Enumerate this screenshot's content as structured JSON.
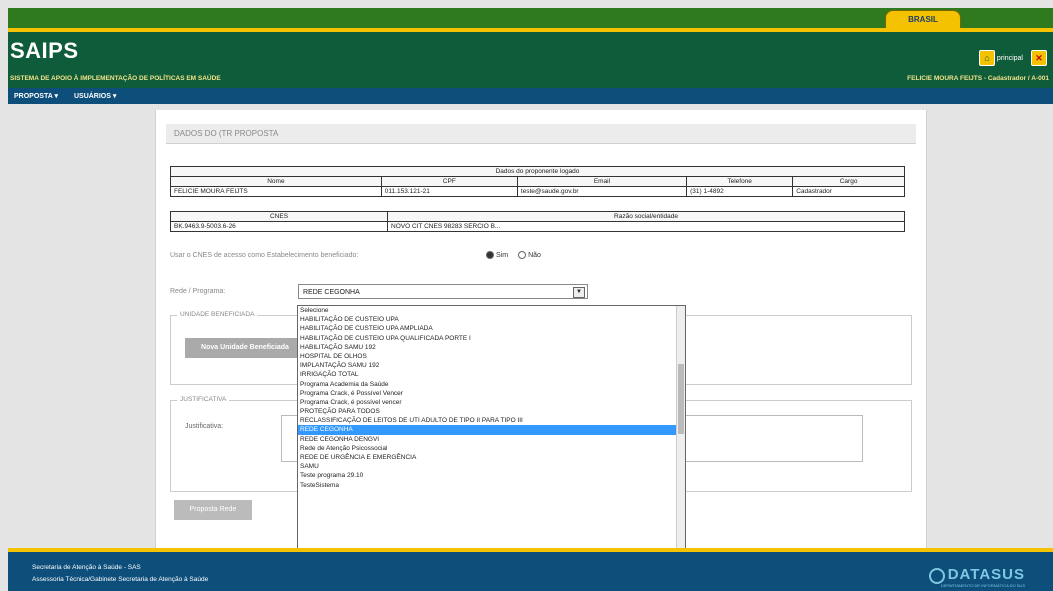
{
  "gov_bar": {
    "tab_label": "BRASIL"
  },
  "header": {
    "app_name": "SAIPS",
    "subtitle": "SISTEMA DE APOIO À IMPLEMENTAÇÃO DE POLÍTICAS EM SAÚDE",
    "user_info": "FELICIE MOURA FEIJTS - Cadastrador / A-001",
    "principal_label": "principal"
  },
  "menu": {
    "items": [
      "PROPOSTA ▾",
      "USUÁRIOS ▾"
    ]
  },
  "panel": {
    "title": "DADOS DO (TR PROPOSTA",
    "table_caption": "Dados do proponente logado",
    "table1_headers": [
      "Nome",
      "CPF",
      "Email",
      "Telefone",
      "Cargo"
    ],
    "table1_row": [
      "FELICIE MOURA FEIJTS",
      "011.153.121-21",
      "teste@saude.gov.br",
      "(31) 1-4892",
      "Cadastrador"
    ],
    "table2_headers": [
      "CNES",
      "Razão social/entidade"
    ],
    "table2_row": [
      "BK.9463.9-5003.6-26",
      "NOVO CIT CNES 98283 SERCIO B..."
    ],
    "question": "Usar o CNES de acesso como Estabelecimento beneficiado:",
    "radio_yes": "Sim",
    "radio_no": "Não",
    "program_label": "Rede / Programa:",
    "select_value": "REDE CEGONHA",
    "fieldset1_legend": "UNIDADE BENEFICIADA",
    "new_button": "Nova Unidade Beneficiada",
    "fieldset2_legend": "JUSTIFICATIVA",
    "justification_label": "Justificativa:",
    "save_button": "Proposta Rede"
  },
  "dropdown": {
    "options": [
      "Selecione",
      "HABILITAÇÃO DE CUSTEIO UPA",
      "HABILITAÇÃO DE CUSTEIO UPA AMPLIADA",
      "HABILITAÇÃO DE CUSTEIO UPA QUALIFICADA PORTE I",
      "HABILITAÇÃO SAMU 192",
      "HOSPITAL DE OLHOS",
      "IMPLANTAÇÃO SAMU 192",
      "IRRIGAÇÃO TOTAL",
      "Programa Academia da Saúde",
      "Programa Crack, é Possível Vencer",
      "Programa Crack, é possível vencer",
      "PROTEÇÃO PARA TODOS",
      "RECLASSIFICAÇÃO DE LEITOS DE UTI ADULTO DE TIPO II PARA TIPO III",
      "REDE CEGONHA",
      "REDE CEGONHA DENGVI",
      "Rede de Atenção Psicossocial",
      "REDE DE URGÊNCIA E EMERGÊNCIA",
      "SAMU",
      "Teste programa 29.10",
      "TesteSistema"
    ],
    "selected_index": 13
  },
  "footer": {
    "line1": "Secretaria de Atenção à Saúde - SAS",
    "line2": "Assessoria Técnica/Gabinete Secretaria de Atenção à Saúde",
    "brand": "DATASUS",
    "brand_sub": "DEPARTAMENTO DE INFORMÁTICA DO SUS"
  }
}
